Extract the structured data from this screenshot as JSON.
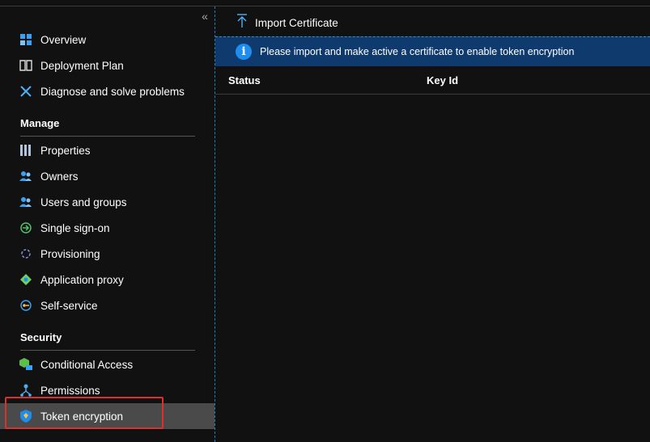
{
  "sidebar": {
    "collapse_glyph": "«",
    "top_items": [
      {
        "label": "Overview",
        "icon": "overview-grid-icon"
      },
      {
        "label": "Deployment Plan",
        "icon": "book-icon"
      },
      {
        "label": "Diagnose and solve problems",
        "icon": "wrench-icon"
      }
    ],
    "manage": {
      "heading": "Manage",
      "items": [
        {
          "label": "Properties",
          "icon": "properties-bars-icon"
        },
        {
          "label": "Owners",
          "icon": "users-icon"
        },
        {
          "label": "Users and groups",
          "icon": "users-icon"
        },
        {
          "label": "Single sign-on",
          "icon": "sign-in-icon"
        },
        {
          "label": "Provisioning",
          "icon": "sync-icon"
        },
        {
          "label": "Application proxy",
          "icon": "app-proxy-icon"
        },
        {
          "label": "Self-service",
          "icon": "key-icon"
        }
      ]
    },
    "security": {
      "heading": "Security",
      "items": [
        {
          "label": "Conditional Access",
          "icon": "conditional-access-icon"
        },
        {
          "label": "Permissions",
          "icon": "permissions-icon"
        },
        {
          "label": "Token encryption",
          "icon": "shield-icon"
        }
      ]
    }
  },
  "toolbar": {
    "import_label": "Import Certificate",
    "import_icon": "upload-arrow-icon"
  },
  "banner": {
    "message": "Please import and make active a certificate to enable token encryption",
    "icon": "info-icon"
  },
  "table": {
    "columns": [
      "Status",
      "Key Id"
    ],
    "rows": []
  },
  "colors": {
    "background": "#111111",
    "active_item": "#4a4a4a",
    "banner_bg": "#0e3a6e",
    "info_blue": "#1f8df0",
    "highlight_red": "#d9312c"
  }
}
